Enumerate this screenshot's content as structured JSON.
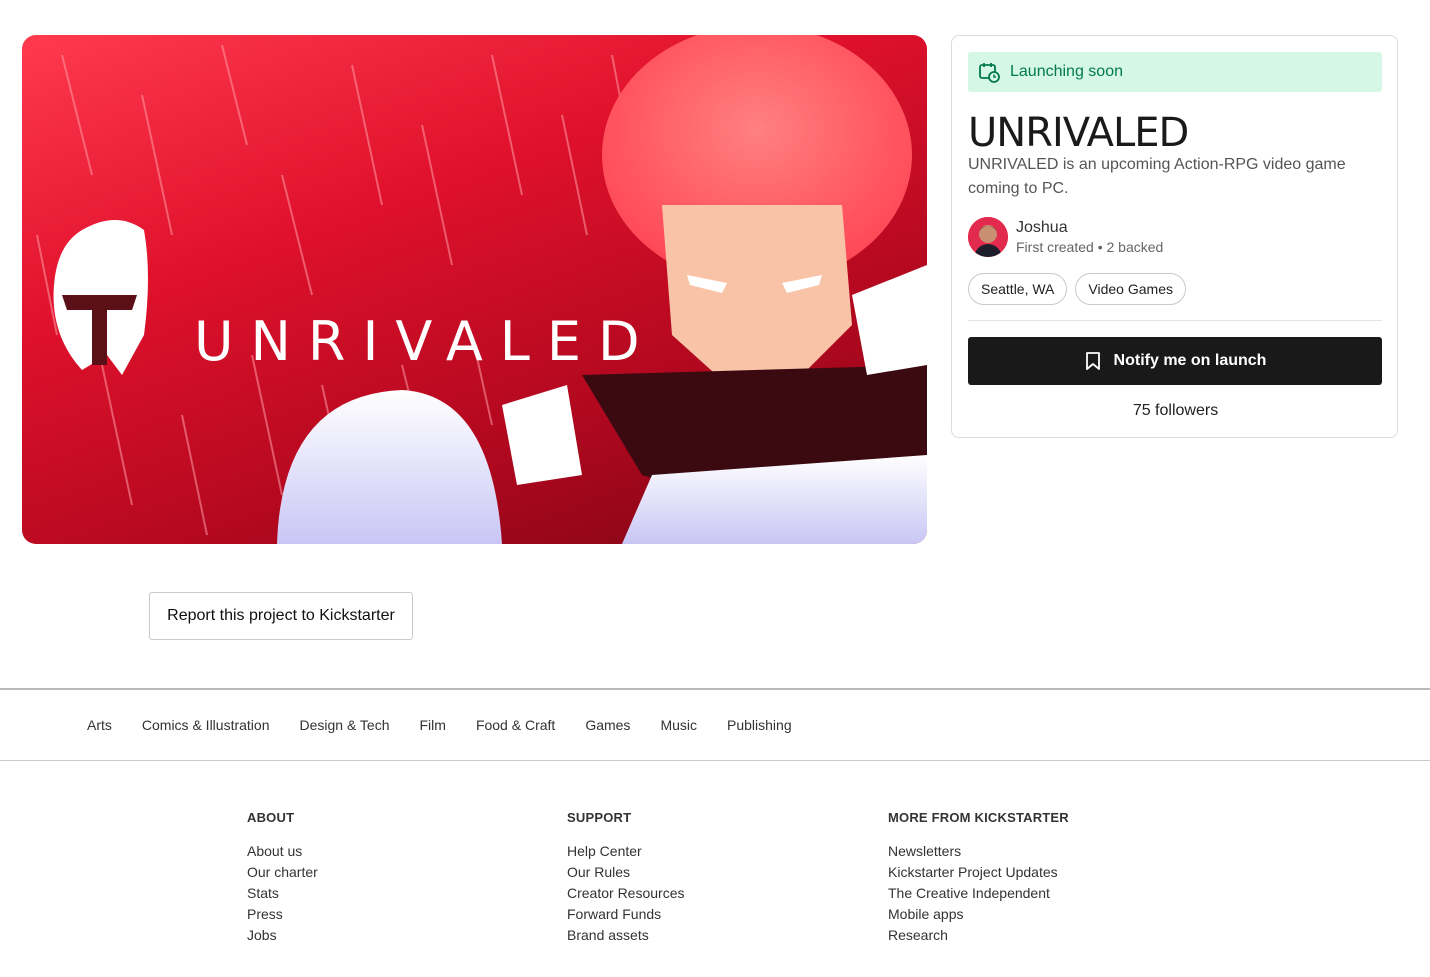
{
  "hero": {
    "wordmark": "UNRIVALED"
  },
  "card": {
    "status_label": "Launching soon",
    "title": "UNRIVALED",
    "blurb": "UNRIVALED is an upcoming Action-RPG video game coming to PC.",
    "creator": {
      "name": "Joshua",
      "meta": "First created • 2 backed"
    },
    "tags": [
      "Seattle, WA",
      "Video Games"
    ],
    "notify_label": "Notify me on launch",
    "followers": "75 followers",
    "colors": {
      "banner_bg": "#d5f7e6",
      "banner_text": "#027a4a",
      "button_bg": "#191919"
    }
  },
  "report_label": "Report this project to Kickstarter",
  "categories": [
    "Arts",
    "Comics & Illustration",
    "Design & Tech",
    "Film",
    "Food & Craft",
    "Games",
    "Music",
    "Publishing"
  ],
  "footer": {
    "about": {
      "heading": "ABOUT",
      "links": [
        "About us",
        "Our charter",
        "Stats",
        "Press",
        "Jobs"
      ]
    },
    "support": {
      "heading": "SUPPORT",
      "links": [
        "Help Center",
        "Our Rules",
        "Creator Resources",
        "Forward Funds",
        "Brand assets"
      ]
    },
    "more": {
      "heading": "MORE FROM KICKSTARTER",
      "links": [
        "Newsletters",
        "Kickstarter Project Updates",
        "The Creative Independent",
        "Mobile apps",
        "Research"
      ]
    }
  }
}
